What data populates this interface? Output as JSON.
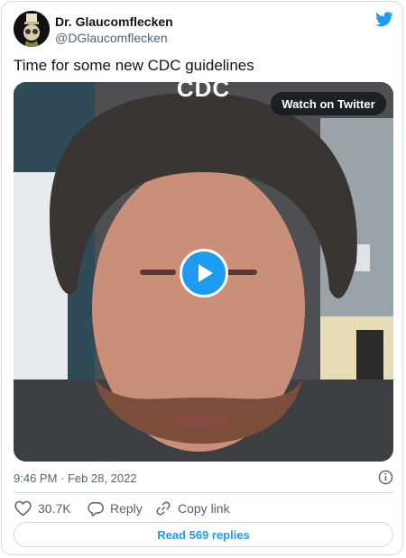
{
  "author": {
    "name": "Dr. Glaucomflecken",
    "handle": "@DGlaucomflecken"
  },
  "tweet": {
    "text": "Time for some new CDC guidelines",
    "timestamp": "9:46 PM · Feb 28, 2022"
  },
  "media": {
    "caption": "CDC",
    "watch_label": "Watch on Twitter",
    "play_icon": "play-icon"
  },
  "actions": {
    "likes": "30.7K",
    "reply_label": "Reply",
    "copy_link_label": "Copy link"
  },
  "read_replies_label": "Read 569 replies",
  "colors": {
    "accent": "#1d9bf0",
    "text": "#0f1419",
    "secondary": "#536471",
    "border": "#cfd9de"
  }
}
